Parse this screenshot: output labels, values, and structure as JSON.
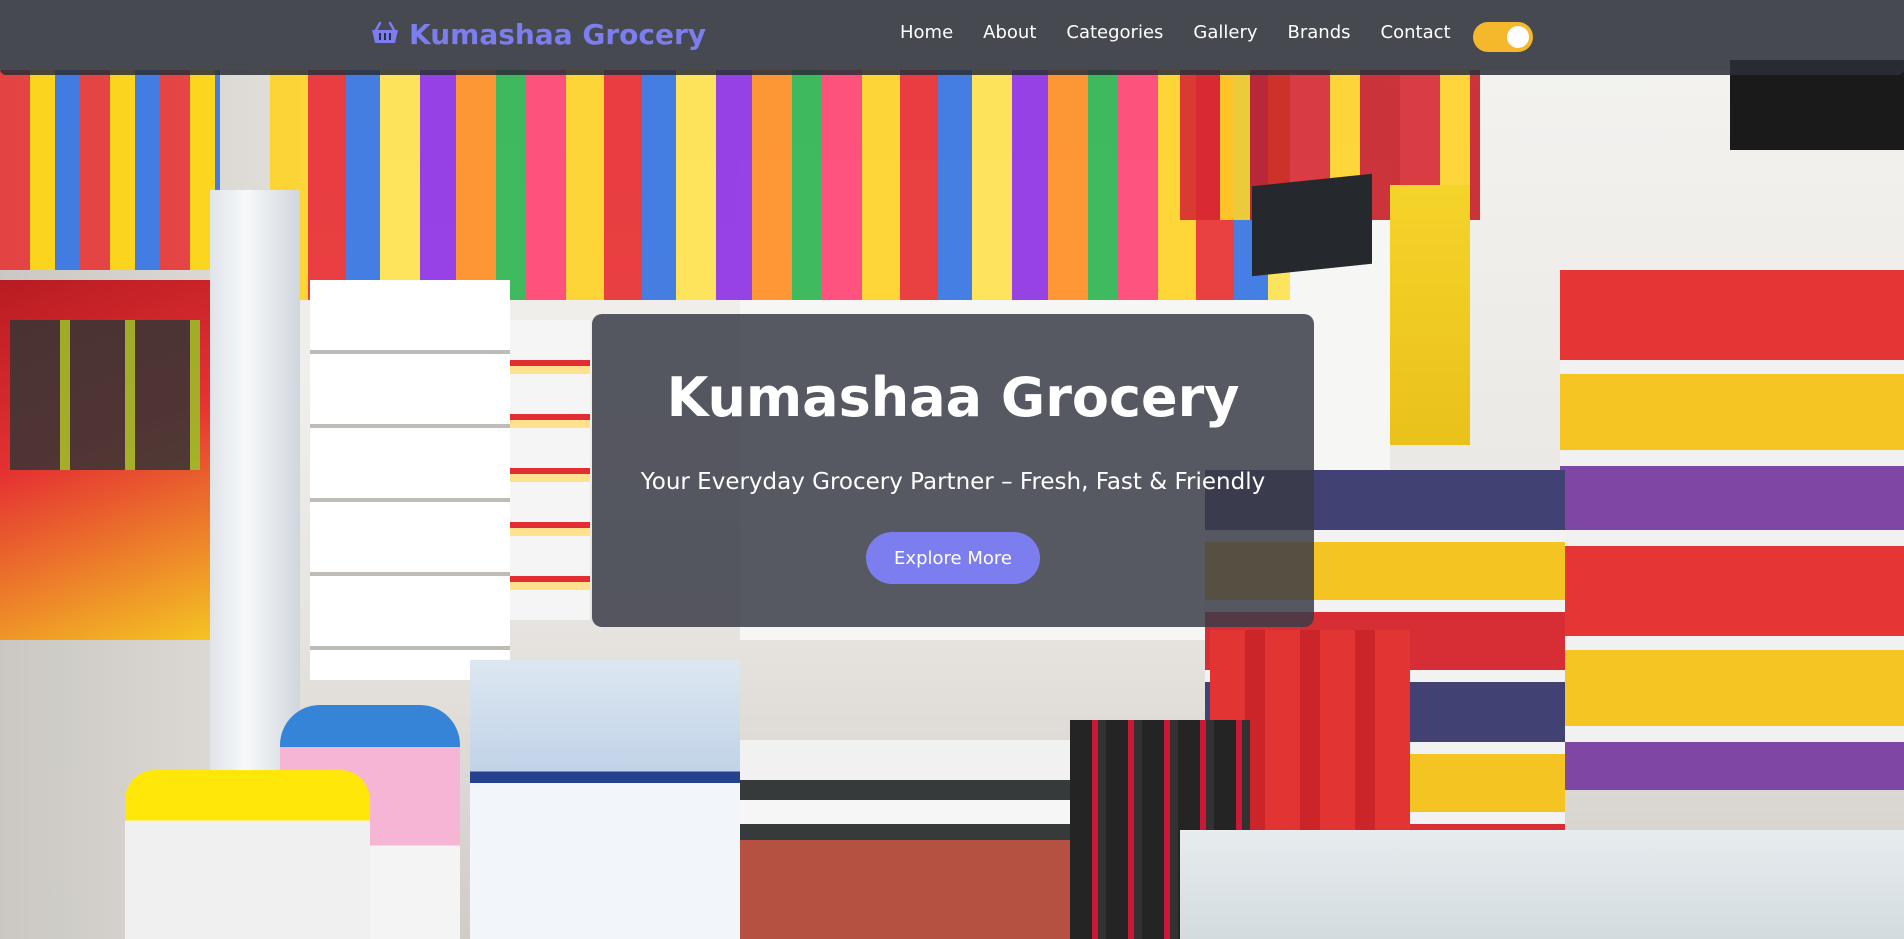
{
  "navbar": {
    "brand": "Kumashaa Grocery",
    "brand_icon": "shopping-basket-icon",
    "brand_color": "#7c7ef0",
    "links": [
      "Home",
      "About",
      "Categories",
      "Gallery",
      "Brands",
      "Contact"
    ],
    "theme_toggle": {
      "state": "on",
      "color": "#f5b82d"
    }
  },
  "hero": {
    "title": "Kumashaa Grocery",
    "subtitle": "Your Everyday Grocery Partner – Fresh, Fast & Friendly",
    "cta_label": "Explore More",
    "cta_color": "#7c7ef0"
  }
}
